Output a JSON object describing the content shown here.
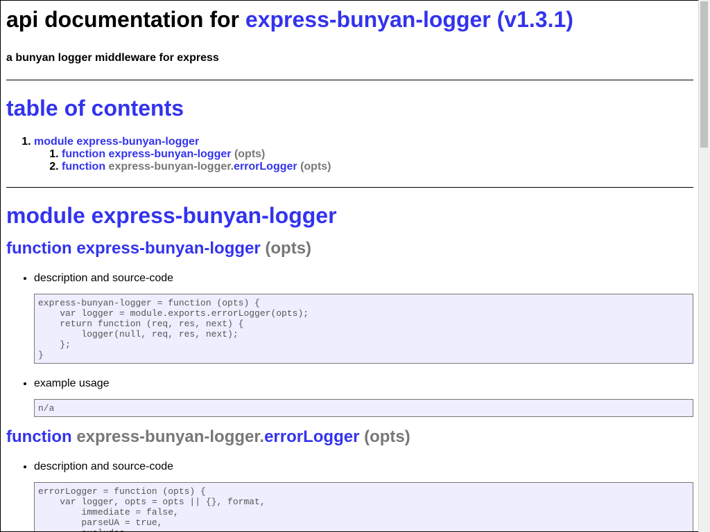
{
  "header": {
    "title_prefix": "api documentation for",
    "package_link": "express-bunyan-logger (v1.3.1)",
    "description": "a bunyan logger middleware for express"
  },
  "toc": {
    "heading": "table of contents",
    "module_link": "module express-bunyan-logger",
    "items": [
      {
        "keyword": "function",
        "name_muted": "",
        "name_link": "express-bunyan-logger",
        "args": "(opts)"
      },
      {
        "keyword": "function",
        "name_muted": "express-bunyan-logger.",
        "name_link": "errorLogger",
        "args": "(opts)"
      }
    ]
  },
  "module": {
    "heading": "module express-bunyan-logger",
    "functions": [
      {
        "keyword": "function",
        "name_muted": "",
        "name_link": "express-bunyan-logger",
        "args": "(opts)",
        "desc_label": "description and source-code",
        "source": "express-bunyan-logger = function (opts) {\n    var logger = module.exports.errorLogger(opts);\n    return function (req, res, next) {\n        logger(null, req, res, next);\n    };\n}",
        "example_label": "example usage",
        "example": "n/a"
      },
      {
        "keyword": "function",
        "name_muted": "express-bunyan-logger.",
        "name_link": "errorLogger",
        "args": "(opts)",
        "desc_label": "description and source-code",
        "source": "errorLogger = function (opts) {\n    var logger, opts = opts || {}, format,\n        immediate = false,\n        parseUA = true,\n        excludes"
      }
    ]
  },
  "colors": {
    "link": "#3333ee",
    "muted": "#777777",
    "code_bg": "#eeeeff"
  }
}
